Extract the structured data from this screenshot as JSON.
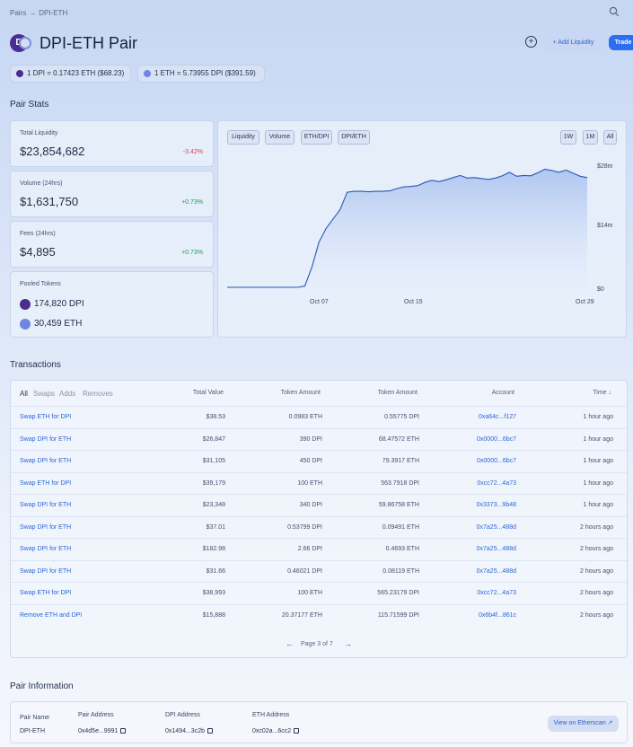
{
  "breadcrumb": {
    "root": "Pairs",
    "sep": "→",
    "current": "DPI-ETH"
  },
  "header": {
    "title": "DPI-ETH Pair",
    "logo_letter": "D",
    "add_liquidity_label": "+ Add Liquidity",
    "trade_label": "Trade"
  },
  "rates": [
    {
      "text": "1 DPI = 0.17423 ETH ($68.23)",
      "icon": "dpi-token-icon",
      "color": "#4a2e8f"
    },
    {
      "text": "1 ETH = 5.73955 DPI ($391.59)",
      "icon": "eth-token-icon",
      "color": "#6f86e0"
    }
  ],
  "pair_stats": {
    "title": "Pair Stats",
    "liquidity": {
      "label": "Total Liquidity",
      "value": "$23,854,682",
      "change": "-3.42%"
    },
    "volume": {
      "label": "Volume (24hrs)",
      "value": "$1,631,750",
      "change": "+0.73%"
    },
    "fees": {
      "label": "Fees (24hrs)",
      "value": "$4,895",
      "change": "+0.73%"
    },
    "pooled": {
      "label": "Pooled Tokens",
      "dpi": "174,820 DPI",
      "eth": "30,459 ETH"
    }
  },
  "chart_tabs": [
    "Liquidity",
    "Volume",
    "ETH/DPI",
    "DPI/ETH"
  ],
  "chart_ranges": [
    "1W",
    "1M",
    "All"
  ],
  "chart_data": {
    "type": "area",
    "series": [
      {
        "values": [
          0.6,
          0.6,
          0.6,
          0.6,
          0.6,
          0.6,
          0.6,
          0.6,
          0.6,
          0.6,
          0.6,
          0.9,
          5.2,
          10.8,
          13.9,
          16.0,
          18.2,
          22.1,
          22.3,
          22.3,
          22.2,
          22.3,
          22.3,
          22.4,
          22.9,
          23.3,
          23.4,
          23.6,
          24.3,
          24.8,
          24.5,
          24.9,
          25.4,
          25.9,
          25.3,
          25.4,
          25.2,
          25.0,
          25.3,
          25.8,
          26.6,
          25.7,
          25.9,
          25.8,
          26.5,
          27.3,
          27.0,
          26.6,
          27.1,
          26.4,
          25.7,
          25.4
        ]
      }
    ],
    "x_ticks": [
      "Oct 07",
      "Oct 15",
      "Oct 29"
    ],
    "y_ticks": [
      "$28m",
      "$14m",
      "$0"
    ],
    "ylim": [
      0,
      28
    ],
    "grid": false
  },
  "transactions": {
    "title": "Transactions",
    "filters": [
      "All",
      "Swaps",
      "Adds",
      "Removes"
    ],
    "columns": [
      "Total Value",
      "Token Amount",
      "Token Amount",
      "Account",
      "Time ↓"
    ],
    "rows": [
      {
        "action": "Swap ETH for DPI",
        "value": "$38.53",
        "amt1": "0.0983 ETH",
        "amt2": "0.55775 DPI",
        "account": "0xa64c...f127",
        "time": "1 hour ago"
      },
      {
        "action": "Swap DPI for ETH",
        "value": "$26,847",
        "amt1": "390 DPI",
        "amt2": "68.47572 ETH",
        "account": "0x0000...6bc7",
        "time": "1 hour ago"
      },
      {
        "action": "Swap DPI for ETH",
        "value": "$31,105",
        "amt1": "450 DPI",
        "amt2": "79.3917 ETH",
        "account": "0x0000...6bc7",
        "time": "1 hour ago"
      },
      {
        "action": "Swap ETH for DPI",
        "value": "$39,179",
        "amt1": "100 ETH",
        "amt2": "563.7918 DPI",
        "account": "0xcc72...4a73",
        "time": "1 hour ago"
      },
      {
        "action": "Swap DPI for ETH",
        "value": "$23,348",
        "amt1": "340 DPI",
        "amt2": "59.86758 ETH",
        "account": "0x3373...9b48",
        "time": "1 hour ago"
      },
      {
        "action": "Swap DPI for ETH",
        "value": "$37.01",
        "amt1": "0.53799 DPI",
        "amt2": "0.09491 ETH",
        "account": "0x7a25...488d",
        "time": "2 hours ago"
      },
      {
        "action": "Swap DPI for ETH",
        "value": "$182.98",
        "amt1": "2.66 DPI",
        "amt2": "0.4693 ETH",
        "account": "0x7a25...488d",
        "time": "2 hours ago"
      },
      {
        "action": "Swap DPI for ETH",
        "value": "$31.66",
        "amt1": "0.46021 DPI",
        "amt2": "0.08119 ETH",
        "account": "0x7a25...488d",
        "time": "2 hours ago"
      },
      {
        "action": "Swap ETH for DPI",
        "value": "$38,993",
        "amt1": "100 ETH",
        "amt2": "565.23179 DPI",
        "account": "0xcc72...4a73",
        "time": "2 hours ago"
      },
      {
        "action": "Remove ETH and DPI",
        "value": "$15,888",
        "amt1": "20.37177 ETH",
        "amt2": "115.71599 DPI",
        "account": "0x6b4f...861c",
        "time": "2 hours ago"
      }
    ],
    "pager": {
      "text": "Page 3 of 7",
      "prev": "←",
      "next": "→"
    }
  },
  "pair_info": {
    "title": "Pair Information",
    "pair_name_label": "Pair Name",
    "pair_name": "DPI-ETH",
    "pair_address_label": "Pair Address",
    "pair_address": "0x4d5e...9991",
    "dpi_address_label": "DPI Address",
    "dpi_address": "0x1494...3c2b",
    "eth_address_label": "ETH Address",
    "eth_address": "0xc02a...6cc2",
    "etherscan_label": "View on Etherscan ↗"
  }
}
